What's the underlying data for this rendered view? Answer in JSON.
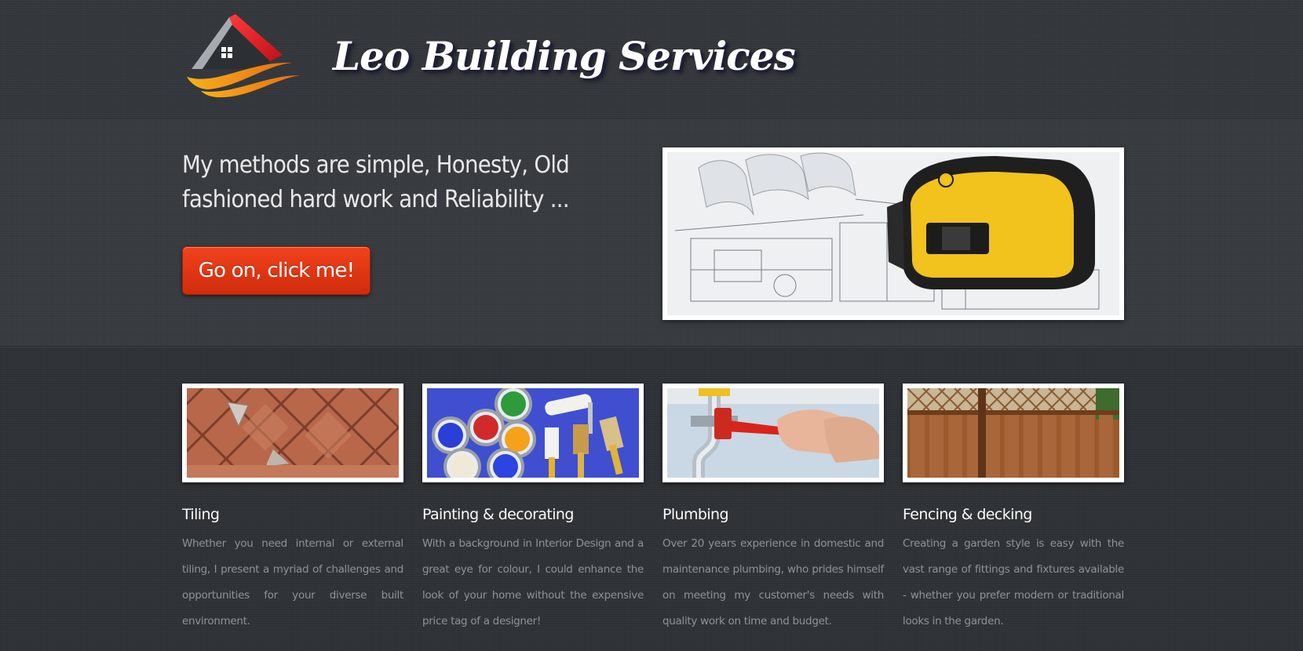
{
  "header": {
    "site_title": "Leo Building Services",
    "logo_icon": "house-roof-logo-icon"
  },
  "hero": {
    "tagline": "My methods are simple, Honesty, Old fashioned hard work and Reliability ...",
    "cta_label": "Go on, click me!",
    "image_icon": "tape-measure-on-blueprints-image"
  },
  "services": [
    {
      "title": "Tiling",
      "description": "Whether you need internal or external tiling, I present a myriad of challenges and opportunities for your diverse built environment.",
      "image_icon": "terracotta-tiles-image"
    },
    {
      "title": "Painting & decorating",
      "description": "With a background in Interior Design and a great eye for colour, I could enhance the look of your home without the expensive price tag of a designer!",
      "image_icon": "paint-cans-and-brushes-image"
    },
    {
      "title": "Plumbing",
      "description": "Over 20 years experience in domestic and maintenance plumbing, who prides himself on meeting my customer's needs with quality work on time and budget.",
      "image_icon": "pipe-wrench-plumbing-image"
    },
    {
      "title": "Fencing & decking",
      "description": "Creating a garden style is easy with the vast range of fittings and fixtures available - whether you prefer modern or traditional looks in the garden.",
      "image_icon": "wooden-fence-image"
    }
  ],
  "colors": {
    "background": "#33373b",
    "cta": "#e0370f",
    "title_shadow": "#1d1f3a",
    "body_text": "#8d939a"
  }
}
